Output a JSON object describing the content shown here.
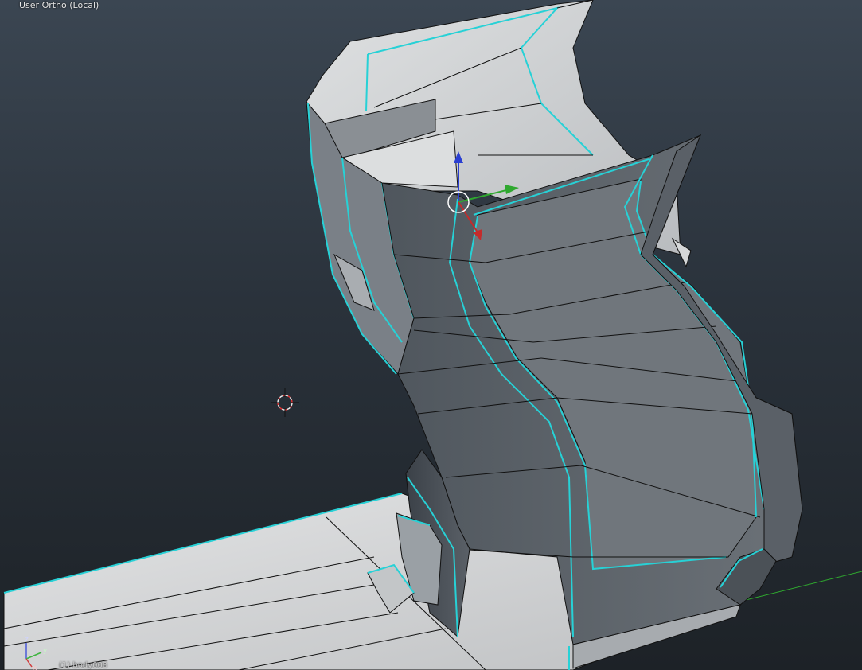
{
  "viewport": {
    "view_title": "User Ortho (Local)",
    "object_label": "(1) body008",
    "axes": {
      "z": "z",
      "y": "y",
      "x": "x"
    }
  },
  "colors": {
    "background_top": "#3b4652",
    "background_bottom": "#1d2227",
    "mesh_light": "#c9ccce",
    "mesh_dark": "#5b6168",
    "selected_edge": "#27d1d6",
    "wire": "#111111",
    "gizmo_z": "#2b3fd1",
    "gizmo_y": "#2fa82f",
    "gizmo_x": "#c52b2b"
  },
  "icons": [
    "3d-cursor-icon",
    "transform-gizmo-icon",
    "axis-orientation-icon"
  ]
}
